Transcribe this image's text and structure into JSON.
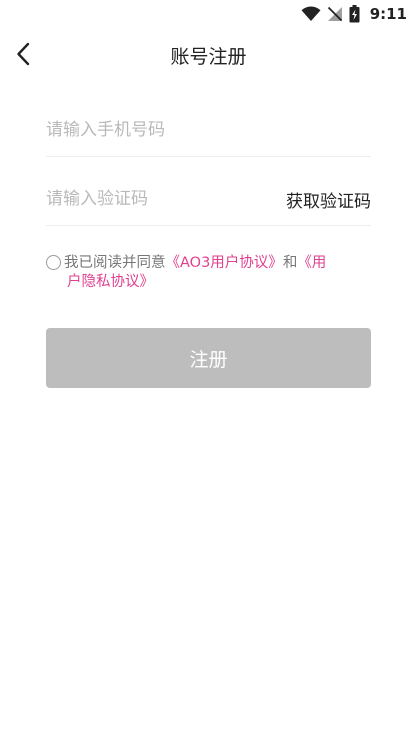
{
  "status_bar": {
    "time": "9:11",
    "icons": [
      "wifi-icon",
      "no-signal-icon",
      "battery-charging-icon"
    ]
  },
  "header": {
    "back_icon": "chevron-left-icon",
    "title": "账号注册"
  },
  "form": {
    "phone": {
      "placeholder": "请输入手机号码",
      "value": ""
    },
    "code": {
      "placeholder": "请输入验证码",
      "value": ""
    },
    "get_code_label": "获取验证码"
  },
  "agreement": {
    "prefix": "我已阅读并同意",
    "user_agreement": "《AO3用户协议》",
    "conjunction": "和",
    "privacy_line1": "《用",
    "privacy_line2": "户隐私协议》",
    "checked": false
  },
  "submit": {
    "label": "注册"
  },
  "colors": {
    "link": "#e0418f",
    "button_disabled": "#bdbdbd",
    "placeholder": "#b9b9b9"
  }
}
